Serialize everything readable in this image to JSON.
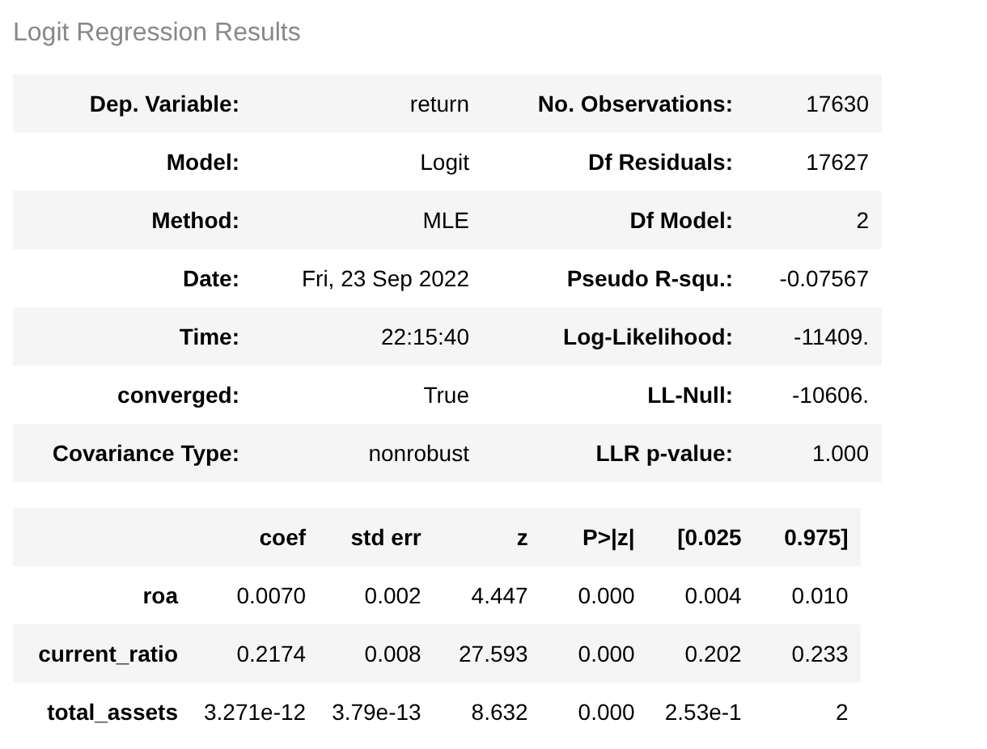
{
  "title": "Logit Regression Results",
  "summary": [
    {
      "label_1": "Dep. Variable:",
      "value_1": "return",
      "label_2": "No. Observations:",
      "value_2": "17630"
    },
    {
      "label_1": "Model:",
      "value_1": "Logit",
      "label_2": "Df Residuals:",
      "value_2": "17627"
    },
    {
      "label_1": "Method:",
      "value_1": "MLE",
      "label_2": "Df Model:",
      "value_2": "2"
    },
    {
      "label_1": "Date:",
      "value_1": "Fri, 23 Sep 2022",
      "label_2": "Pseudo R-squ.:",
      "value_2": "-0.07567"
    },
    {
      "label_1": "Time:",
      "value_1": "22:15:40",
      "label_2": "Log-Likelihood:",
      "value_2": "-11409."
    },
    {
      "label_1": "converged:",
      "value_1": "True",
      "label_2": "LL-Null:",
      "value_2": "-10606."
    },
    {
      "label_1": "Covariance Type:",
      "value_1": "nonrobust",
      "label_2": "LLR p-value:",
      "value_2": "1.000"
    }
  ],
  "coefficients": {
    "columns": [
      "coef",
      "std err",
      "z",
      "P>|z|",
      "[0.025",
      "0.975]"
    ],
    "rows": [
      {
        "name": "roa",
        "values": [
          "0.0070",
          "0.002",
          "4.447",
          "0.000",
          "0.004",
          "0.010"
        ]
      },
      {
        "name": "current_ratio",
        "values": [
          "0.2174",
          "0.008",
          "27.593",
          "0.000",
          "0.202",
          "0.233"
        ]
      },
      {
        "name": "total_assets",
        "values": [
          "3.271e-12",
          "3.79e-13",
          "8.632",
          "0.000",
          "2.53e-1",
          "2"
        ]
      }
    ]
  }
}
